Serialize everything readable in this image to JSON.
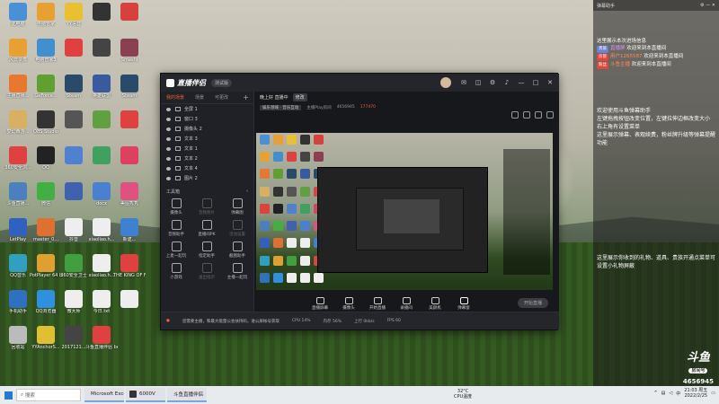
{
  "desktop": {
    "icons": [
      {
        "label": "此电脑",
        "color": "#4a90d9"
      },
      {
        "label": "电脑管家",
        "color": "#e8a030"
      },
      {
        "label": "YY语音",
        "color": "#e8c030"
      },
      {
        "label": "",
        "color": "#333"
      },
      {
        "label": "",
        "color": "#d84040"
      },
      {
        "label": "风云录像",
        "color": "#e8a030"
      },
      {
        "label": "电脑管家3",
        "color": "#4090d0"
      },
      {
        "label": "",
        "color": "#e04040"
      },
      {
        "label": "",
        "color": "#444"
      },
      {
        "label": "Smashi",
        "color": "#8a4050"
      },
      {
        "label": "主播直播...",
        "color": "#e87830"
      },
      {
        "label": "GeForce...",
        "color": "#60a030"
      },
      {
        "label": "Steam",
        "color": "#2a4a6a"
      },
      {
        "label": "英雄联盟",
        "color": "#3a5aa0"
      },
      {
        "label": "Steam",
        "color": "#2a4a6a"
      },
      {
        "label": "梦幻西游...",
        "color": "#d8b060"
      },
      {
        "label": "OBS Studio",
        "color": "#333"
      },
      {
        "label": "",
        "color": "#555"
      },
      {
        "label": "",
        "color": "#60a040"
      },
      {
        "label": "",
        "color": "#e04040"
      },
      {
        "label": "360安全浏...",
        "color": "#e04040"
      },
      {
        "label": "QQ",
        "color": "#222"
      },
      {
        "label": "",
        "color": "#5080d0"
      },
      {
        "label": "",
        "color": "#40a060"
      },
      {
        "label": "",
        "color": "#e04060"
      },
      {
        "label": "斗鱼直播...",
        "color": "#4a80c0"
      },
      {
        "label": "微信",
        "color": "#40b040"
      },
      {
        "label": "",
        "color": "#4060b0"
      },
      {
        "label": "docx",
        "color": "#4a80d0"
      },
      {
        "label": "美图秀秀",
        "color": "#e05080"
      },
      {
        "label": "LetPlay",
        "color": "#3060c0"
      },
      {
        "label": "master_0...",
        "color": "#e07030"
      },
      {
        "label": "抖音",
        "color": "#eee"
      },
      {
        "label": "xiaoliao.h...",
        "color": "#eee"
      },
      {
        "label": "新建...",
        "color": "#4080d0"
      },
      {
        "label": "QQ音乐",
        "color": "#30a0c0"
      },
      {
        "label": "PotPlayer 64 bit",
        "color": "#e0a030"
      },
      {
        "label": "360安全卫士",
        "color": "#40a040"
      },
      {
        "label": "xiaoliao.h...",
        "color": "#eee"
      },
      {
        "label": "THE KING OF FIGHT...",
        "color": "#e04040"
      },
      {
        "label": "手机助手",
        "color": "#3070c0"
      },
      {
        "label": "QQ浏览器",
        "color": "#3090e0"
      },
      {
        "label": "微大师",
        "color": "#eee"
      },
      {
        "label": "今日.txt",
        "color": "#eee"
      },
      {
        "label": "",
        "color": "#eee"
      },
      {
        "label": "回收站",
        "color": "#bbb"
      },
      {
        "label": "YYAnchorS...",
        "color": "#e0c030"
      },
      {
        "label": "2017121...",
        "color": "#444"
      },
      {
        "label": "斗鱼直播伴侣 beta(0.7.42...",
        "color": "#e04040"
      }
    ]
  },
  "window": {
    "app_name": "直播伴侣",
    "version_badge": "测试版",
    "left_tabs": [
      "我的场景",
      "场景",
      "可更改"
    ],
    "add_label": "+",
    "sources": [
      "全屏 1",
      "窗口 3",
      "摄像头 2",
      "文本 3",
      "文本 1",
      "文本 2",
      "文本 4",
      "图片 2"
    ],
    "tools_header": "工具箱",
    "tools": [
      {
        "label": "摄像头",
        "dim": false
      },
      {
        "label": "音频图片",
        "dim": true
      },
      {
        "label": "弹幕图",
        "dim": false
      },
      {
        "label": "音频助手",
        "dim": false
      },
      {
        "label": "直播间PK",
        "dim": false
      },
      {
        "label": "活动设置",
        "dim": true
      },
      {
        "label": "上麦一起玩",
        "dim": false
      },
      {
        "label": "指定助手",
        "dim": false
      },
      {
        "label": "截图助手",
        "dim": false
      },
      {
        "label": "小游戏",
        "dim": false
      },
      {
        "label": "送出指示",
        "dim": true
      },
      {
        "label": "主播一起玩",
        "dim": false
      }
    ],
    "stream_title": "晚上好 直播中",
    "stream_tag": "修改",
    "sub_category": "娱乐领域 · 音乐互动",
    "sub_id": "主播Play房间",
    "sub_stat1": "4656945",
    "sub_stat2": "177470",
    "bottom_buttons": [
      "直播屏幕",
      "摄像头",
      "开始直播",
      "录播间",
      "美颜机",
      "弹幕窗"
    ],
    "live_button": "开始直播",
    "status_notice": "您需要主播，和最大能量公会扶持码，进公屏帐号获取",
    "status_items": [
      "CPU 14%",
      "内存 56%",
      "上行 0kb/s",
      "FPS 60"
    ]
  },
  "chat": {
    "header": "弹幕助手",
    "lines": [
      {
        "kind": "notice",
        "text": "这里展示本次进场信息"
      },
      {
        "kind": "user",
        "badge": "贵族",
        "badge_color": "blue",
        "user": "直播屏",
        "text": "欢迎来到本直播间"
      },
      {
        "kind": "user",
        "badge": "房管",
        "badge_color": "red",
        "user": "用户1265587",
        "text": "欢迎来到本直播间"
      },
      {
        "kind": "user",
        "badge": "粉丝",
        "badge_color": "red",
        "user": "斗鱼主播",
        "text": "欢迎来到本直播间"
      }
    ],
    "tips": [
      "欢迎使用斗鱼弹幕助手",
      "左键拖拽按钮改变位置，左键拉伸边框改变大小",
      "右上角有设置菜单",
      "这里展示弹幕、表观续费，粉丝牌升级等弹幕提醒功能"
    ],
    "gift_tip": "这里展示你收到的礼物、道具、贵族开通点菜单可设置小礼物屏蔽",
    "brand": "斗鱼",
    "room_label": "房间号",
    "room_id": "4656945"
  },
  "taskbar": {
    "search_placeholder": "搜索",
    "tasks": [
      {
        "label": "Microsoft Excel",
        "color": "#1e7a3e"
      },
      {
        "label": "6000V",
        "color": "#333"
      },
      {
        "label": "斗鱼直播伴侣",
        "color": "#e04040"
      }
    ],
    "weather": "32°C",
    "weather_sub": "CPU温度",
    "time": "21:03 周五",
    "date": "2022/2/25"
  },
  "colors": {
    "accent": "#e8623a",
    "panel": "#1d1f24"
  }
}
